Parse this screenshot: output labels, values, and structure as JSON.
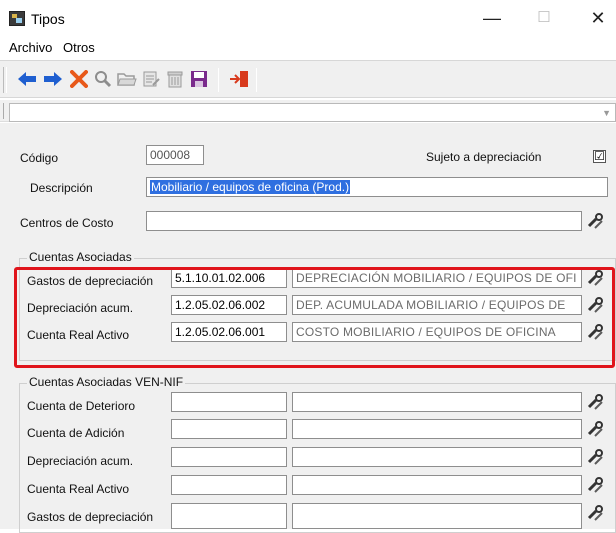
{
  "window": {
    "title": "Tipos",
    "minimize": "—",
    "maximize": "☐",
    "close": "✕"
  },
  "menu": [
    "Archivo",
    "Otros"
  ],
  "toolbar": {
    "buttons": [
      {
        "name": "back-arrow-icon",
        "glyph": "🡸",
        "color": "#1f5fd0"
      },
      {
        "name": "forward-arrow-icon",
        "glyph": "🡺",
        "color": "#1f5fd0"
      },
      {
        "name": "cancel-x-icon",
        "glyph": "✖",
        "color": "#e8591a"
      },
      {
        "name": "search-icon",
        "glyph": "🔍",
        "color": "#888888"
      },
      {
        "name": "open-folder-icon",
        "glyph": "🗁",
        "color": "#999999"
      },
      {
        "name": "edit-document-icon",
        "glyph": "🖹",
        "color": "#999999"
      },
      {
        "name": "trash-icon",
        "glyph": "🗑",
        "color": "#999999"
      },
      {
        "name": "save-disk-icon",
        "glyph": "🖫",
        "color": "#7a2a8c"
      },
      {
        "name": "exit-door-icon",
        "glyph": "⇥",
        "color": "#d83a1d"
      }
    ]
  },
  "form": {
    "codigo": {
      "label": "Código",
      "value": "000008"
    },
    "sujeto": {
      "label": "Sujeto a depreciación",
      "checked": "☑"
    },
    "descripcion": {
      "label": "Descripción",
      "value": "Mobiliario / equipos de oficina (Prod.)"
    },
    "centros": {
      "label": "Centros de Costo",
      "value": ""
    }
  },
  "cuentas_asociadas": {
    "title": "Cuentas Asociadas",
    "rows": [
      {
        "label": "Gastos de depreciación",
        "code": "5.1.10.01.02.006",
        "desc": "DEPRECIACIÓN MOBILIARIO / EQUIPOS DE OFI"
      },
      {
        "label": "Depreciación acum.",
        "code": "1.2.05.02.06.002",
        "desc": "DEP. ACUMULADA MOBILIARIO / EQUIPOS DE"
      },
      {
        "label": "Cuenta Real Activo",
        "code": "1.2.05.02.06.001",
        "desc": "COSTO MOBILIARIO / EQUIPOS DE OFICINA"
      }
    ]
  },
  "cuentas_ven_nif": {
    "title": "Cuentas Asociadas VEN-NIF",
    "rows": [
      {
        "label": "Cuenta de Deterioro",
        "code": "",
        "desc": ""
      },
      {
        "label": "Cuenta de Adición",
        "code": "",
        "desc": ""
      },
      {
        "label": "Depreciación acum.",
        "code": "",
        "desc": ""
      },
      {
        "label": "Cuenta Real Activo",
        "code": "",
        "desc": ""
      },
      {
        "label": "Gastos de depreciación",
        "code": "",
        "desc": ""
      }
    ]
  },
  "colors": {
    "highlight_border": "#e0141b",
    "selection": "#2f6fe0"
  }
}
